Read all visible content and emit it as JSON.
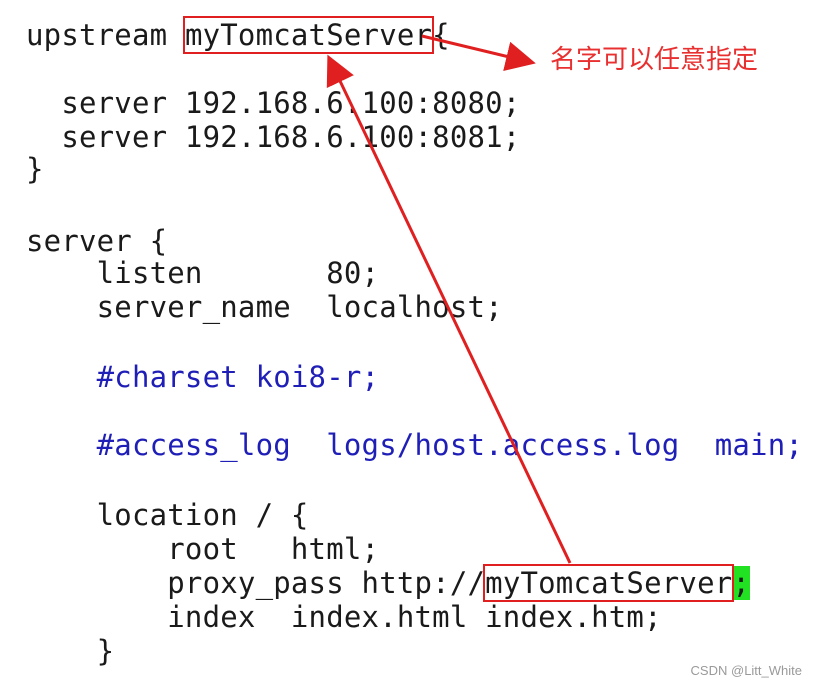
{
  "code": {
    "lines": [
      {
        "segments": [
          {
            "text": "upstream "
          },
          {
            "text": "myTomcatServer",
            "boxed": true
          },
          {
            "text": "{"
          }
        ]
      },
      {
        "segments": [
          {
            "text": "  server 192.168.6.100:8080;"
          }
        ]
      },
      {
        "segments": [
          {
            "text": "  server 192.168.6.100:8081;"
          }
        ]
      },
      {
        "segments": [
          {
            "text": "}"
          }
        ]
      },
      {
        "segments": [
          {
            "text": "server {"
          }
        ]
      },
      {
        "segments": [
          {
            "text": "    listen       80;"
          }
        ]
      },
      {
        "segments": [
          {
            "text": "    server_name  localhost;"
          }
        ]
      },
      {
        "segments": [
          {
            "text": "    #charset koi8-r;"
          }
        ],
        "style": "comment"
      },
      {
        "segments": [
          {
            "text": "    #access_log  logs/host.access.log  main;"
          }
        ],
        "style": "comment"
      },
      {
        "segments": [
          {
            "text": "    location / {"
          }
        ]
      },
      {
        "segments": [
          {
            "text": "        root   html;"
          }
        ]
      },
      {
        "segments": [
          {
            "text": "        proxy_pass http://"
          },
          {
            "text": "myTomcatServer",
            "boxed": true
          },
          {
            "text": ";",
            "cursor": true
          }
        ]
      },
      {
        "segments": [
          {
            "text": "        index  index.html index.htm;"
          }
        ]
      },
      {
        "segments": [
          {
            "text": "    }"
          }
        ]
      }
    ]
  },
  "annotation": {
    "text": "名字可以任意指定"
  },
  "watermark": {
    "text": "CSDN @Litt_White"
  },
  "colors": {
    "text": "#1a1a1a",
    "comment": "#1f1fb8",
    "highlight_box": "#e02020",
    "arrow": "#e02020",
    "annotation": "#e83030",
    "cursor": "#22e022",
    "watermark": "#9a9a9a"
  }
}
